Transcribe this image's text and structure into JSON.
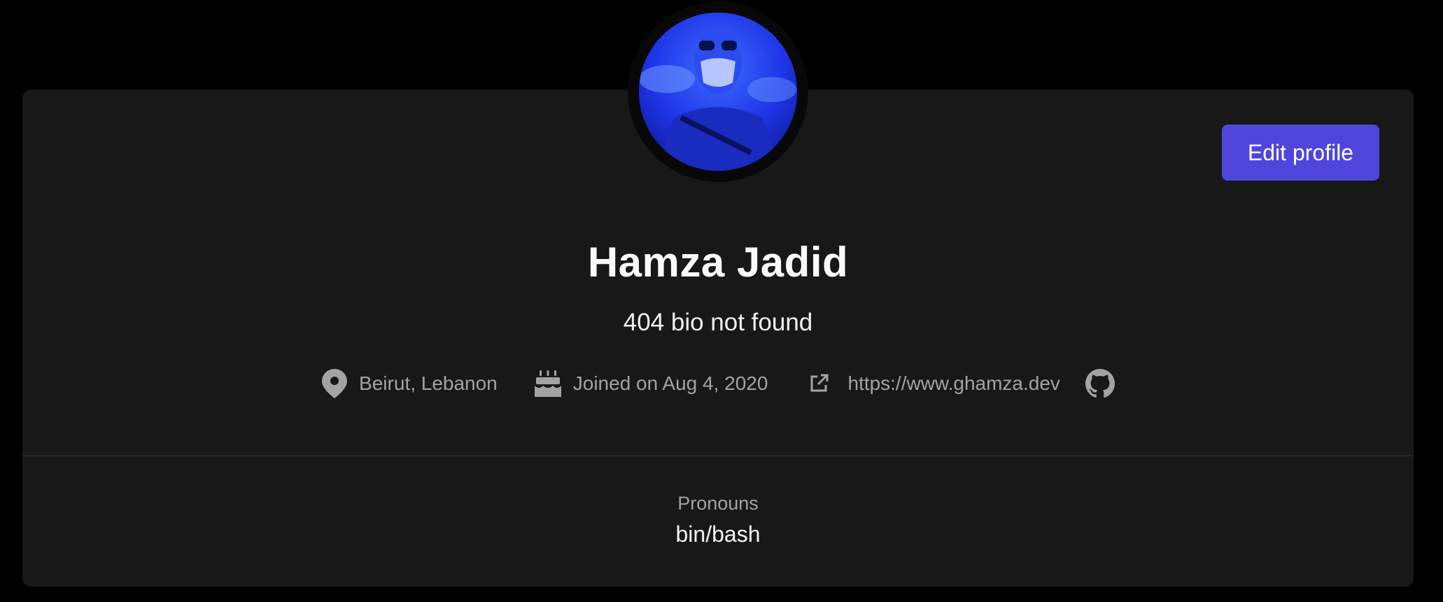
{
  "profile": {
    "name": "Hamza Jadid",
    "bio": "404 bio not found",
    "edit_button": "Edit profile",
    "location": "Beirut, Lebanon",
    "joined": "Joined on Aug 4, 2020",
    "website": "https://www.ghamza.dev",
    "pronouns_label": "Pronouns",
    "pronouns_value": "bin/bash"
  },
  "icons": {
    "location": "map-pin-icon",
    "joined": "cake-icon",
    "website": "external-link-icon",
    "github": "github-icon"
  },
  "colors": {
    "page_background": "#000000",
    "card_background": "#181818",
    "accent": "#4e46dc",
    "muted_text": "#a3a3a3",
    "avatar_tint": "#1f33e6"
  }
}
